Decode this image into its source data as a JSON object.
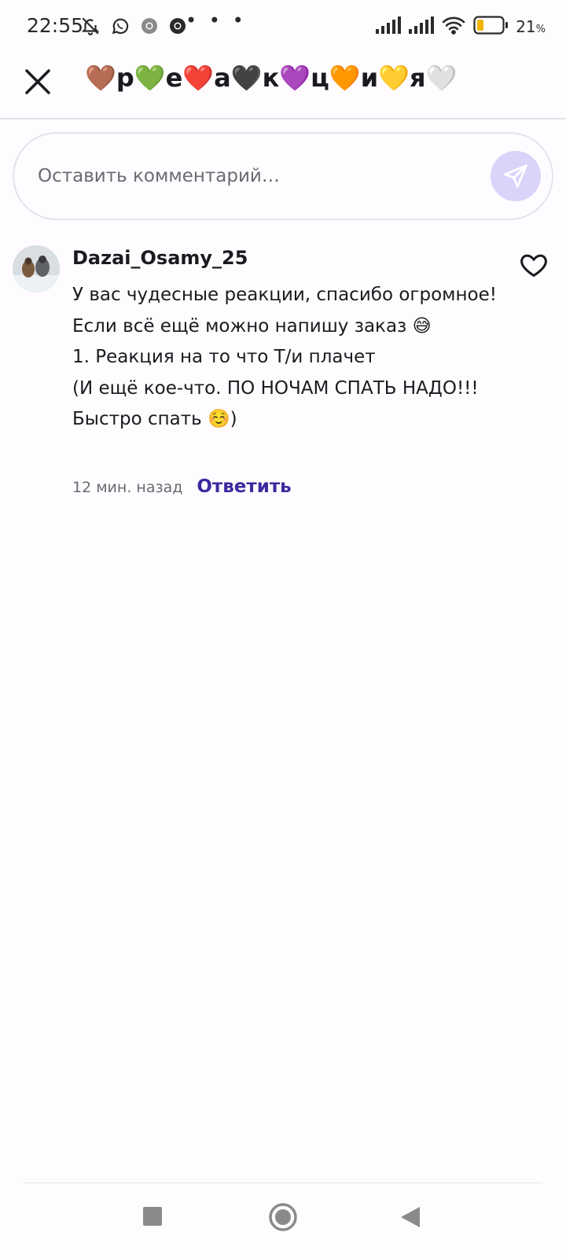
{
  "status_bar": {
    "time": "22:55",
    "dots": "• • •",
    "battery_percent": "21",
    "battery_percent_sign": "%"
  },
  "header": {
    "title": "🤎р💚е❤️а🖤к💜ц🧡и💛я🤍"
  },
  "comment_input": {
    "placeholder": "Оставить комментарий…",
    "value": ""
  },
  "comment": {
    "username": "Dazai_Osamy_25",
    "text": "У вас чудесные реакции, спасибо огромное! Если всё ещё можно напишу заказ 😅\n1. Реакция на то что Т/и плачет\n(И ещё кое-что. ПО НОЧАМ СПАТЬ НАДО!!! Быстро спать ☺️)",
    "time": "12 мин. назад",
    "reply_label": "Ответить"
  },
  "colors": {
    "accent": "#3b2aa0",
    "send_button_bg": "#dcd3fb",
    "send_icon": "#ffffff",
    "battery_fill": "#f4b400"
  }
}
